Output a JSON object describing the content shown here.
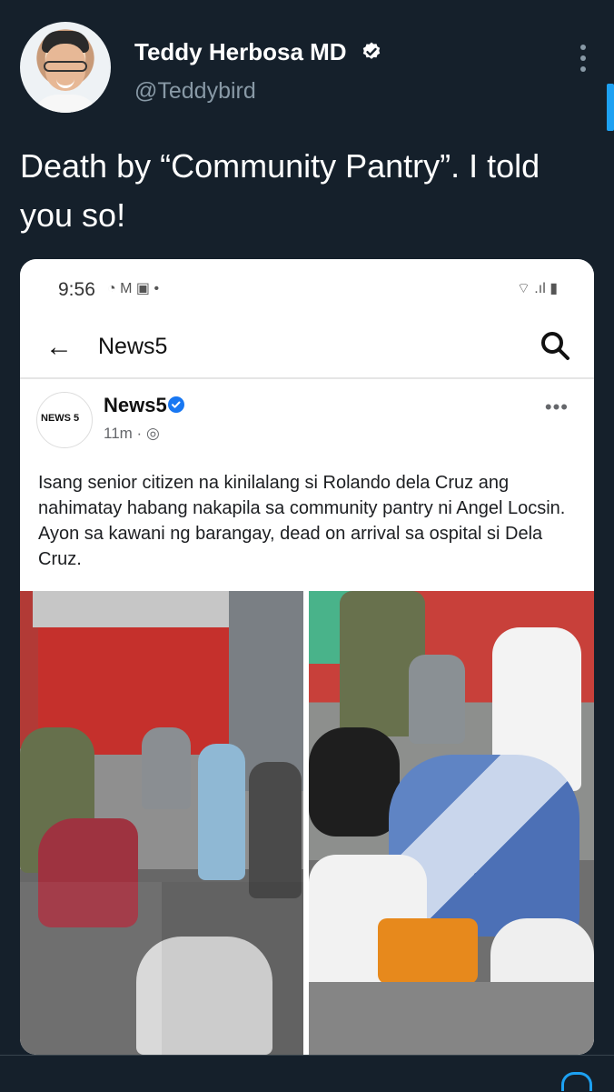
{
  "tweet": {
    "author": {
      "display_name": "Teddy Herbosa MD",
      "handle": "@Teddybird"
    },
    "text": "Death by  “Community Pantry”. I told you so!"
  },
  "embedded_screenshot": {
    "status_bar": {
      "time": "9:56",
      "left_icons": "◔ M ▣ •",
      "right_icons": "⌔ .ıl ▮"
    },
    "app_bar": {
      "title": "News5"
    },
    "post": {
      "page_name": "News5",
      "avatar_label": "NEWS 5",
      "time": "11m ·",
      "body": "Isang senior citizen na kinilalang si Rolando dela Cruz ang nahimatay habang nakapila sa community pantry ni Angel Locsin. Ayon sa kawani ng barangay, dead on arrival sa ospital si Dela Cruz."
    }
  },
  "bottom_bar": {
    "text": ""
  },
  "colors": {
    "background": "#15202b",
    "text_primary": "#ffffff",
    "text_secondary": "#8899a6",
    "accent": "#1da1f2",
    "facebook_blue": "#1877f2"
  }
}
